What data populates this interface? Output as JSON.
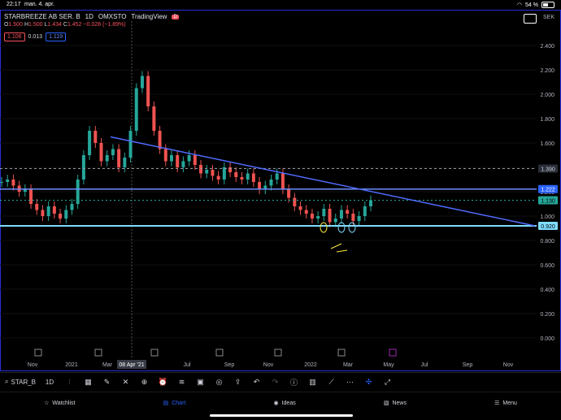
{
  "status": {
    "time": "22:17",
    "date": "man. 4. apr.",
    "battery": "54 %"
  },
  "header": {
    "symbol_name": "STARBREEZE AB SER. B",
    "interval": "1D",
    "exchange": "OMXSTO",
    "source": "TradingView",
    "badge": "D"
  },
  "ohlc": {
    "o_label": "O",
    "o": "1.500",
    "h_label": "H",
    "h": "1.500",
    "l_label": "L",
    "l": "1.434",
    "c_label": "C",
    "c": "1.452",
    "change": "−0.028 (−1.89%)"
  },
  "bidask": {
    "bid": "1.106",
    "spread": "0.013",
    "ask": "1.119"
  },
  "currency": "SEK",
  "price_axis": [
    "2.400",
    "2.200",
    "2.000",
    "1.800",
    "1.600",
    "1.400",
    "1.200",
    "1.000",
    "0.800",
    "0.600",
    "0.400",
    "0.200",
    "0.000"
  ],
  "price_labels": {
    "h1390": "1.390",
    "h1222": "1.222",
    "last": "1.130",
    "support": "0.920"
  },
  "time_axis": [
    "Nov",
    "2021",
    "Mar",
    "Apr",
    "Jul",
    "Sep",
    "Nov",
    "2022",
    "Mar",
    "May",
    "Jul",
    "Sep",
    "Nov"
  ],
  "crosshair_date": "08 Apr '21",
  "toolbar": {
    "symbol": "STAR_B",
    "interval": "1D"
  },
  "nav": [
    {
      "label": "Watchlist",
      "icon": "star-icon"
    },
    {
      "label": "Chart",
      "icon": "chart-icon"
    },
    {
      "label": "Ideas",
      "icon": "bulb-icon"
    },
    {
      "label": "News",
      "icon": "news-icon"
    },
    {
      "label": "Menu",
      "icon": "menu-icon"
    }
  ],
  "chart_data": {
    "type": "candlestick-like line",
    "y_range": [
      0,
      2.4
    ],
    "series": [
      {
        "values": [
          1.28,
          1.3,
          1.25,
          1.2,
          1.22,
          1.1,
          1.05,
          1.0,
          1.08,
          1.02,
          0.98,
          1.05,
          1.1,
          1.3,
          1.5,
          1.7,
          1.6,
          1.45,
          1.5,
          1.55,
          1.4,
          1.48,
          1.7,
          2.05,
          2.15,
          1.9,
          1.7,
          1.55,
          1.45,
          1.5,
          1.4,
          1.45,
          1.5,
          1.42,
          1.35,
          1.38,
          1.33,
          1.3,
          1.4,
          1.36,
          1.32,
          1.3,
          1.35,
          1.28,
          1.22,
          1.25,
          1.3,
          1.35,
          1.22,
          1.15,
          1.08,
          1.05,
          1.02,
          0.98,
          1.0,
          1.06,
          0.95,
          0.98,
          1.05,
          1.02,
          0.96,
          1.0,
          1.08,
          1.13
        ]
      }
    ],
    "lines": {
      "resistance_1390": 1.39,
      "resistance_1222": 1.222,
      "support_0920": 0.92
    }
  }
}
